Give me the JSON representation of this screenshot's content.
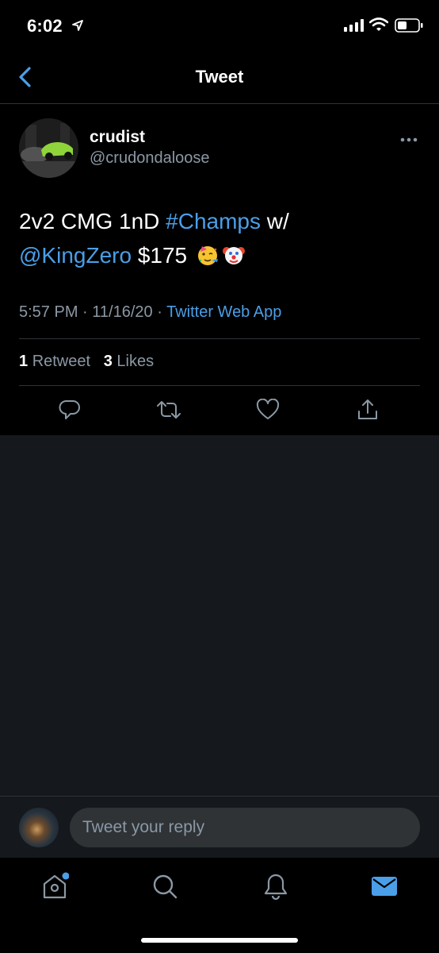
{
  "status_bar": {
    "time": "6:02"
  },
  "header": {
    "title": "Tweet"
  },
  "tweet": {
    "author_name": "crudist",
    "author_handle": "@crudondaloose",
    "text_parts": {
      "plain1": "2v2 CMG 1nD ",
      "hashtag": "#Champs",
      "plain2": " w/",
      "mention": "@KingZero",
      "plain3": " $175"
    },
    "emojis": [
      "partying-face-emoji",
      "clown-face-emoji"
    ],
    "time": "5:57 PM",
    "date": "11/16/20",
    "source": "Twitter Web App",
    "retweet_count": "1",
    "retweet_label": "Retweet",
    "like_count": "3",
    "like_label": "Likes"
  },
  "reply": {
    "placeholder": "Tweet your reply"
  },
  "tab_bar": {
    "items": [
      "home-icon",
      "search-icon",
      "notifications-icon",
      "messages-icon"
    ],
    "active": "messages-icon",
    "home_has_badge": true
  },
  "colors": {
    "accent": "#4a9fe8",
    "background": "#000000",
    "empty_area": "#15181c",
    "secondary_text": "#8b98a5"
  }
}
